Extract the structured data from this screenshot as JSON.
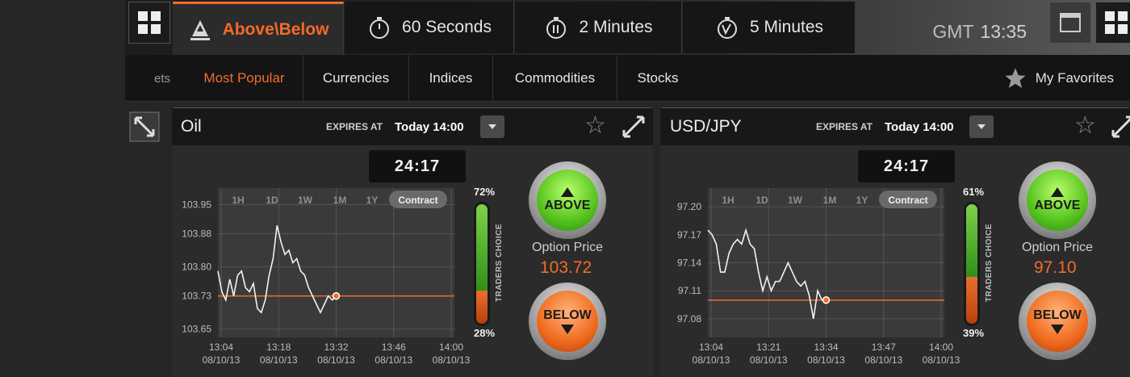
{
  "top_tabs": [
    {
      "label": "Above\\Below",
      "icon": "above-below-icon"
    },
    {
      "label": "60 Seconds",
      "icon": "stopwatch-icon"
    },
    {
      "label": "2 Minutes",
      "icon": "stopwatch-icon"
    },
    {
      "label": "5 Minutes",
      "icon": "stopwatch-icon"
    }
  ],
  "clock": {
    "zone": "GMT",
    "time": "13:35"
  },
  "categories": {
    "cut_label": "ets",
    "items": [
      "Most Popular",
      "Currencies",
      "Indices",
      "Commodities",
      "Stocks"
    ],
    "active": "Most Popular",
    "favorites": "My Favorites"
  },
  "accent_color": "#f26b2a",
  "panels": [
    {
      "asset": "Oil",
      "expires_label": "EXPIRES AT",
      "expires_value": "Today 14:00",
      "countdown": "24:17",
      "ranges": [
        "1H",
        "1D",
        "1W",
        "1M",
        "1Y",
        "Contract"
      ],
      "traders_choice_label": "TRADERS CHOICE",
      "above_pct": "72%",
      "below_pct": "28%",
      "above_fraction": 0.72,
      "above_label": "ABOVE",
      "below_label": "BELOW",
      "option_price_label": "Option Price",
      "option_price": "103.72"
    },
    {
      "asset": "USD/JPY",
      "expires_label": "EXPIRES AT",
      "expires_value": "Today 14:00",
      "countdown": "24:17",
      "ranges": [
        "1H",
        "1D",
        "1W",
        "1M",
        "1Y",
        "Contract"
      ],
      "traders_choice_label": "TRADERS CHOICE",
      "above_pct": "61%",
      "below_pct": "39%",
      "above_fraction": 0.61,
      "above_label": "ABOVE",
      "below_label": "BELOW",
      "option_price_label": "Option Price",
      "option_price": "97.10"
    }
  ],
  "chart_data": [
    {
      "type": "line",
      "title": "",
      "y_ticks": [
        "103.95",
        "103.88",
        "103.80",
        "103.73",
        "103.65"
      ],
      "x_ticks": [
        [
          "13:04",
          "08/10/13"
        ],
        [
          "13:18",
          "08/10/13"
        ],
        [
          "13:32",
          "08/10/13"
        ],
        [
          "13:46",
          "08/10/13"
        ],
        [
          "14:00",
          "08/10/13"
        ]
      ],
      "ylim": [
        103.63,
        103.99
      ],
      "strike": 103.73,
      "series": [
        {
          "x": [
            0,
            1,
            2,
            3,
            4,
            5,
            6,
            7,
            8,
            9,
            10,
            11,
            12,
            13,
            14,
            15,
            16,
            17,
            18,
            19,
            20,
            21,
            22,
            23,
            24,
            25,
            26,
            27,
            28,
            29,
            30
          ],
          "y": [
            103.79,
            103.74,
            103.72,
            103.77,
            103.73,
            103.78,
            103.79,
            103.75,
            103.74,
            103.76,
            103.7,
            103.69,
            103.72,
            103.78,
            103.82,
            103.9,
            103.86,
            103.83,
            103.84,
            103.81,
            103.82,
            103.79,
            103.78,
            103.75,
            103.73,
            103.71,
            103.69,
            103.71,
            103.73,
            103.72,
            103.73
          ]
        }
      ],
      "xlim": [
        0,
        60
      ]
    },
    {
      "type": "line",
      "title": "",
      "y_ticks": [
        "97.20",
        "97.17",
        "97.14",
        "97.11",
        "97.08"
      ],
      "x_ticks": [
        [
          "13:04",
          "08/10/13"
        ],
        [
          "13:21",
          "08/10/13"
        ],
        [
          "13:34",
          "08/10/13"
        ],
        [
          "13:47",
          "08/10/13"
        ],
        [
          "14:00",
          "08/10/13"
        ]
      ],
      "ylim": [
        97.06,
        97.22
      ],
      "strike": 97.1,
      "series": [
        {
          "x": [
            0,
            1,
            2,
            3,
            4,
            5,
            6,
            7,
            8,
            9,
            10,
            11,
            12,
            13,
            14,
            15,
            16,
            17,
            18,
            19,
            20,
            21,
            22,
            23,
            24,
            25,
            26,
            27,
            28
          ],
          "y": [
            97.175,
            97.17,
            97.16,
            97.13,
            97.13,
            97.15,
            97.16,
            97.165,
            97.16,
            97.175,
            97.16,
            97.155,
            97.13,
            97.11,
            97.125,
            97.11,
            97.12,
            97.12,
            97.13,
            97.14,
            97.13,
            97.12,
            97.115,
            97.12,
            97.105,
            97.08,
            97.11,
            97.1,
            97.1
          ]
        }
      ],
      "xlim": [
        0,
        56
      ]
    }
  ]
}
